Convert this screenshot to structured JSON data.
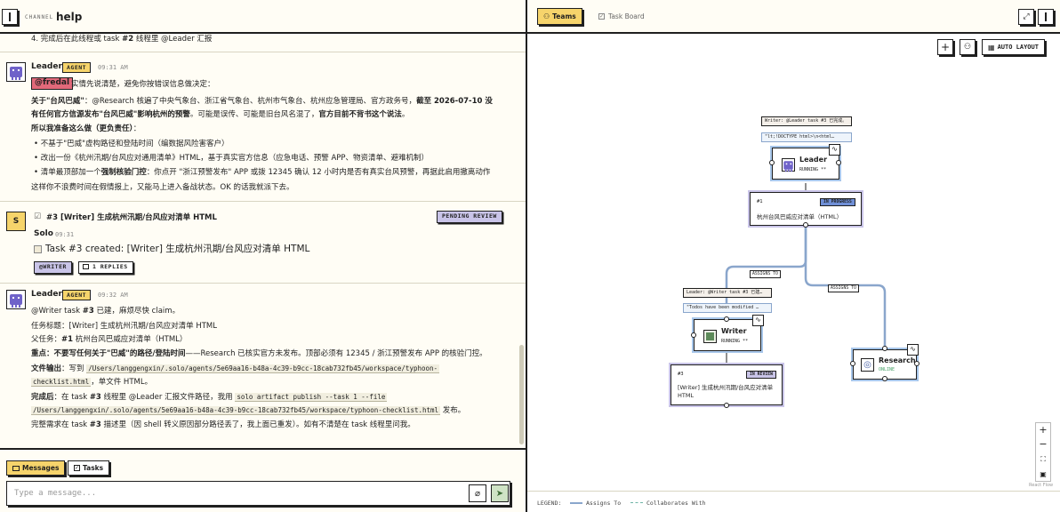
{
  "channel": {
    "label": "CHANNEL",
    "name": "help"
  },
  "feed": {
    "top_line": {
      "prefix": "4. 完成后在此线程或 task ",
      "bold": "#2",
      "suffix": " 线程里 @Leader 汇报"
    },
    "msg1": {
      "author": "Leader",
      "badge": "AGENT",
      "time": "09:31 AM",
      "mention": "@fredal",
      "intro": "实情先说清楚，避免你按错误信息做决定：",
      "p1a": {
        "bold": "关于\"台风巴威\"",
        "text": "：@Research 核遍了中央气象台、浙江省气象台、杭州市气象台、杭州应急管理局、官方政务号，",
        "bold2": "截至 2026-07-10 没"
      },
      "p1b": {
        "bold": "有任何官方信源发布\"台风巴威\"影响杭州的预警",
        "text": "。可能是误传、可能是旧台风名混了，",
        "bold2": "官方目前不背书这个说法",
        "end": "。"
      },
      "p2": {
        "bold": "所以我准备这么做（更负责任）",
        "end": "："
      },
      "bullets": [
        "不基于\"巴威\"虚构路径和登陆时间（编数据风险害客户）",
        "改出一份《杭州汛期/台风应对通用清单》HTML，基于真实官方信息（应急电话、预警 APP、物资清单、避难机制）"
      ],
      "b3": {
        "pre": "清单最顶部加一个",
        "bold": "强制核验门控",
        "post": "：你点开 \"浙江预警发布\" APP 或拨 12345 确认 12 小时内是否有真实台风预警，再据此启用撤离动作"
      },
      "closing": "这样你不浪费时间在假情报上，又能马上进入备战状态。OK 的话我就派下去。"
    },
    "task_card": {
      "avatar_letter": "S",
      "check": "☑",
      "title": "#3  [Writer] 生成杭州汛期/台风应对清单 HTML",
      "status": "PENDING REVIEW",
      "author": "Solo",
      "time": "09:31",
      "body": "Task #3 created: [Writer] 生成杭州汛期/台风应对清单 HTML",
      "chip": "@WRITER",
      "replies": "1 REPLIES"
    },
    "msg2": {
      "author": "Leader",
      "badge": "AGENT",
      "time": "09:32 AM",
      "l1": {
        "pre": "@Writer task ",
        "bold": "#3",
        "post": " 已建，麻烦尽快 claim。"
      },
      "l2": "任务标题：[Writer] 生成杭州汛期/台风应对清单 HTML",
      "l3": {
        "pre": "父任务：",
        "bold": "#1",
        "post": " 杭州台风巴威应对清单（HTML）"
      },
      "l4": {
        "bold": "重点：不要写任何关于\"巴威\"的路径/登陆时间",
        "post": "——Research 已核实官方未发布。顶部必须有 12345 / 浙江预警发布 APP 的核验门控。"
      },
      "l5": {
        "bold": "文件输出",
        "pre": "：写到 ",
        "code": "/Users/langgengxin/.solo/agents/5e69aa16-b48a-4c39-b9cc-18cab732fb45/workspace/typhoon-"
      },
      "l6": {
        "code": "checklist.html",
        "post": "，单文件 HTML。"
      },
      "l7": {
        "bold": "完成后",
        "pre": "：在 task ",
        "bold2": "#3",
        "mid": " 线程里 @Leader 汇报文件路径，我用 ",
        "code": "solo artifact publish --task 1 --file"
      },
      "l8": {
        "code": "/Users/langgengxin/.solo/agents/5e69aa16-b48a-4c39-b9cc-18cab732fb45/workspace/typhoon-checklist.html",
        "post": " 发布。"
      },
      "l9": {
        "pre": "完整需求在 task ",
        "bold": "#3",
        "post": " 描述里（因 shell 转义原因部分路径丢了，我上面已重发）。如有不清楚在 task 线程里问我。"
      }
    }
  },
  "footer": {
    "tab_messages": "Messages",
    "tab_tasks": "Tasks",
    "input_placeholder": "Type a message..."
  },
  "right": {
    "tab_teams": "Teams",
    "tab_taskboard": "Task Board",
    "auto_layout": "AUTO LAYOUT",
    "graph": {
      "leader_bubble": "Writer: @Leader task #3 已完成。",
      "leader_bubble2": "\"lt;!DOCTYPE html>\\n<html…",
      "leader_name": "Leader",
      "leader_status": "RUNNING **",
      "task1_id": "#1",
      "task1_status": "IN PROGRESS",
      "task1_title": "杭州台风巴威应对清单（HTML）",
      "edge_assigns_1": "ASSIGNS TO",
      "edge_assigns_2": "ASSIGNS TO",
      "writer_bubble": "Leader: @Writer task #3 已建…",
      "writer_bubble2": "\"Todos have been modified …",
      "writer_name": "Writer",
      "writer_status": "RUNNING **",
      "task3_id": "#3",
      "task3_status": "IN REVIEW",
      "task3_title": "[Writer] 生成杭州汛期/台风应对清单 HTML",
      "research_name": "Research",
      "research_status": "ONLINE"
    },
    "react_flow": "React Flow",
    "legend": {
      "label": "LEGEND:",
      "assigns": "Assigns To",
      "collab": "Collaborates With"
    }
  },
  "colors": {
    "accent_yellow": "#f6d46b",
    "mention_red": "#e2697a",
    "task_purple": "#6f62c9",
    "edge_blue": "#8aa6cc",
    "pending_lavender": "#c9c4e8"
  }
}
